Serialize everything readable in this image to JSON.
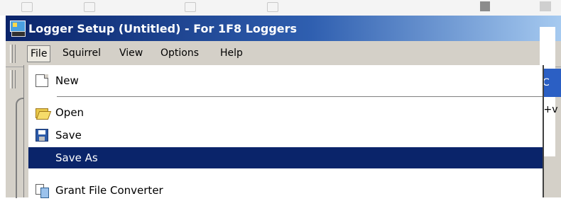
{
  "window": {
    "title": "Logger Setup (Untitled) - For 1F8 Loggers",
    "app_icon": "logger-app-icon"
  },
  "menubar": {
    "items": [
      "File",
      "Squirrel",
      "View",
      "Options",
      "Help"
    ],
    "active": "File"
  },
  "file_menu": {
    "items": [
      {
        "label": "New",
        "icon": "new-document-icon"
      },
      {
        "label": "Open",
        "icon": "open-folder-icon"
      },
      {
        "label": "Save",
        "icon": "floppy-disk-icon"
      },
      {
        "label": "Save As",
        "icon": "",
        "highlighted": true
      },
      {
        "label": "Grant File Converter",
        "icon": "file-converter-icon"
      }
    ],
    "highlight_color": "#0a246a"
  },
  "background": {
    "right_blue_text": "C",
    "right_text": "(+v"
  },
  "colors": {
    "title_start": "#0a246a",
    "title_end": "#a6caf0",
    "face": "#d4d0c8"
  }
}
